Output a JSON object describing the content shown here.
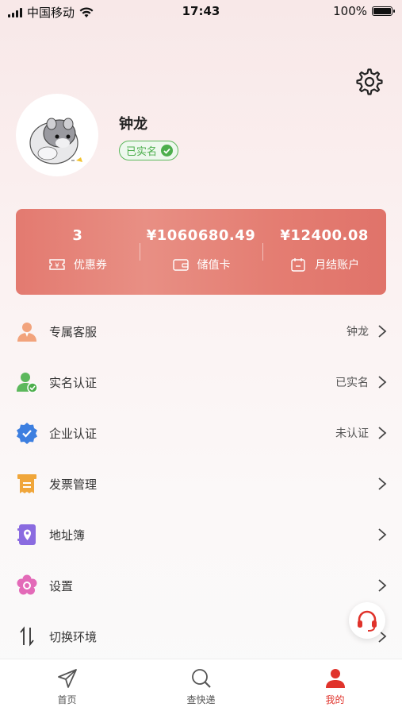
{
  "status_bar": {
    "carrier": "中国移动",
    "time": "17:43",
    "battery": "100%"
  },
  "profile": {
    "name": "钟龙",
    "badge": "已实名"
  },
  "stats": [
    {
      "value": "3",
      "label": "优惠券",
      "icon": "ticket-icon"
    },
    {
      "value": "¥1060680.49",
      "label": "储值卡",
      "icon": "wallet-icon"
    },
    {
      "value": "¥12400.08",
      "label": "月结账户",
      "icon": "calendar-icon"
    }
  ],
  "menu": [
    {
      "label": "专属客服",
      "value": "钟龙",
      "icon": "customer-service-person-icon"
    },
    {
      "label": "实名认证",
      "value": "已实名",
      "icon": "user-verified-icon"
    },
    {
      "label": "企业认证",
      "value": "未认证",
      "icon": "enterprise-badge-icon"
    },
    {
      "label": "发票管理",
      "value": "",
      "icon": "invoice-icon"
    },
    {
      "label": "地址簿",
      "value": "",
      "icon": "address-book-icon"
    },
    {
      "label": "设置",
      "value": "",
      "icon": "flower-settings-icon"
    },
    {
      "label": "切换环境",
      "value": "",
      "icon": "switch-arrows-icon"
    }
  ],
  "tabs": [
    {
      "label": "首页",
      "icon": "paper-plane-icon",
      "active": false
    },
    {
      "label": "查快递",
      "icon": "search-icon",
      "active": false
    },
    {
      "label": "我的",
      "icon": "user-icon",
      "active": true
    }
  ],
  "colors": {
    "accent": "#e0332b",
    "card": "#e47d72",
    "verified": "#4cae4c"
  }
}
